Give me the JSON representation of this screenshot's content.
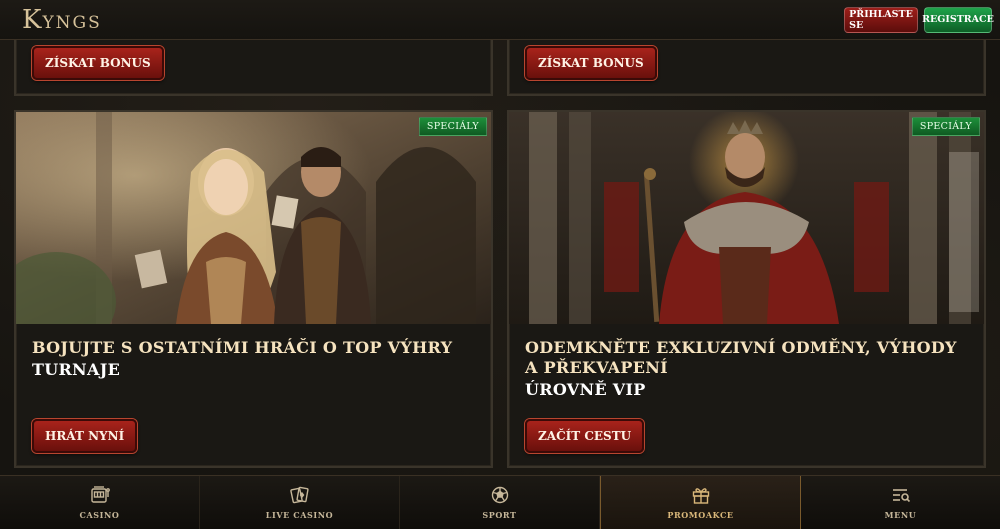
{
  "header": {
    "logo": "KYNGS",
    "login_label": "PŘIHLASTE SE",
    "register_label": "REGISTRACE"
  },
  "top_cards": [
    {
      "button_label": "ZÍSKAT BONUS"
    },
    {
      "button_label": "ZÍSKAT BONUS"
    }
  ],
  "promos": [
    {
      "badge": "SPECIÁLY",
      "title": "BOJUJTE S OSTATNÍMI HRÁČI O TOP VÝHRY",
      "subtitle": "TURNAJE",
      "button_label": "HRÁT NYNÍ"
    },
    {
      "badge": "SPECIÁLY",
      "title": "ODEMKNĚTE EXKLUZIVNÍ ODMĚNY, VÝHODY A PŘEKVAPENÍ",
      "subtitle": "ÚROVNĚ VIP",
      "button_label": "ZAČÍT CESTU"
    }
  ],
  "bottom_nav": [
    {
      "label": "CASINO",
      "icon": "slot-machine-icon"
    },
    {
      "label": "LIVE CASINO",
      "icon": "cards-icon"
    },
    {
      "label": "SPORT",
      "icon": "soccer-ball-icon"
    },
    {
      "label": "PROMOAKCE",
      "icon": "gift-icon",
      "active": true
    },
    {
      "label": "MENU",
      "icon": "menu-search-icon"
    }
  ],
  "colors": {
    "accent_red": "#a8231b",
    "accent_green": "#1ea34a",
    "gold_text": "#f6e3bf",
    "background": "#161410"
  }
}
